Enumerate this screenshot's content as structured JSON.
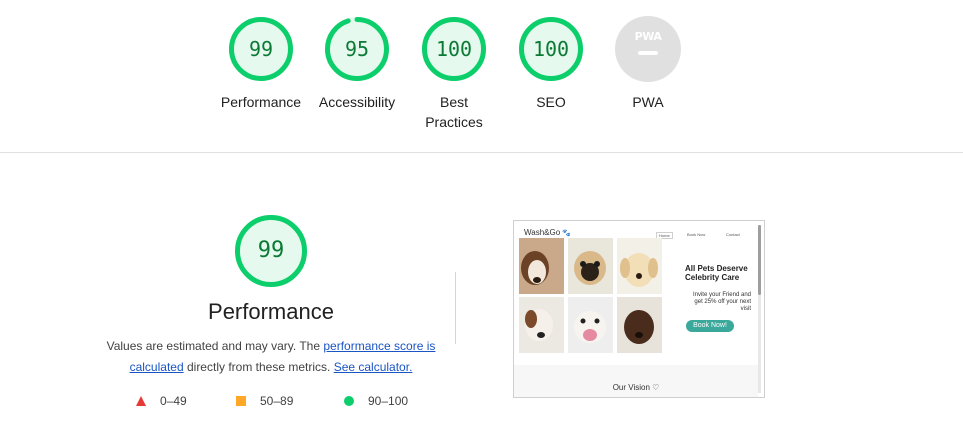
{
  "categories": [
    {
      "id": "performance",
      "score": "99",
      "fraction": 0.99,
      "label": "Performance"
    },
    {
      "id": "accessibility",
      "score": "95",
      "fraction": 0.95,
      "label": "Accessibility"
    },
    {
      "id": "best-practices",
      "score": "100",
      "fraction": 1.0,
      "label": "Best Practices"
    },
    {
      "id": "seo",
      "score": "100",
      "fraction": 1.0,
      "label": "SEO"
    }
  ],
  "pwa": {
    "badge": "PWA",
    "label": "PWA"
  },
  "performance": {
    "score": "99",
    "fraction": 0.99,
    "title": "Performance",
    "desc_prefix": "Values are estimated and may vary. The ",
    "link_score": "performance score is calculated",
    "desc_middle": " directly from these metrics. ",
    "link_calc": "See calculator."
  },
  "legend": [
    {
      "range": "0–49",
      "shape": "triangle",
      "color": "#e53935"
    },
    {
      "range": "50–89",
      "shape": "square",
      "color": "#ffa726"
    },
    {
      "range": "90–100",
      "shape": "circle",
      "color": "#0cce6b"
    }
  ],
  "colors": {
    "pass": "#0cce6b",
    "pass_text": "#0a7a34",
    "pass_fill": "#e5f9ee",
    "neutral": "#e0e0e0"
  },
  "thumbnail": {
    "brand": "Wash&Go",
    "nav": [
      "Home",
      "Book Now",
      "Contact"
    ],
    "headline": "All Pets Deserve Celebrity Care",
    "subtext": "Invite your Friend and get 25% off your next visit",
    "button": "Book Now!",
    "section": "Our Vision ♡"
  }
}
